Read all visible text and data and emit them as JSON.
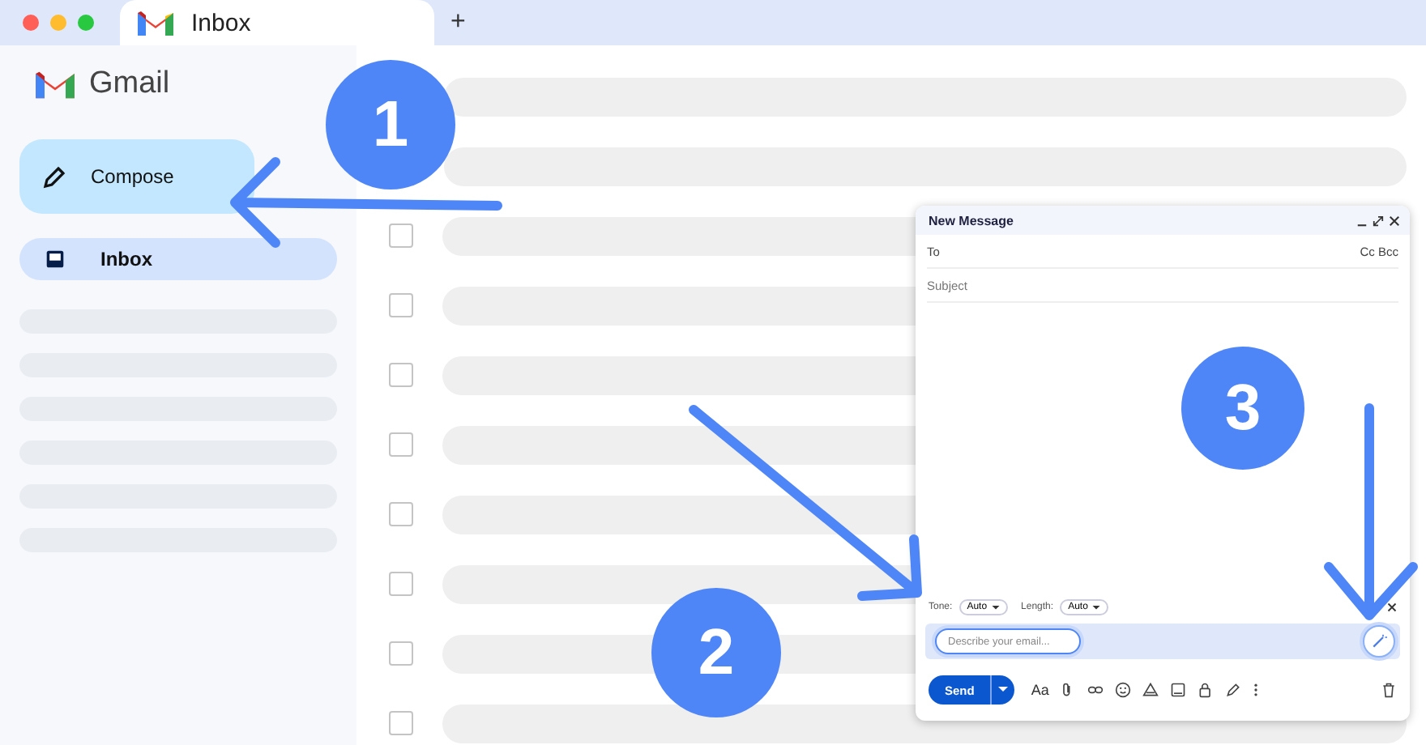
{
  "browser": {
    "tab_title": "Inbox",
    "new_tab": "+"
  },
  "sidebar": {
    "logo_text": "Gmail",
    "compose_label": "Compose",
    "items": [
      {
        "kind": "inbox",
        "label": "Inbox",
        "selected": true
      },
      {
        "kind": "placeholder"
      },
      {
        "kind": "placeholder"
      },
      {
        "kind": "placeholder"
      },
      {
        "kind": "placeholder"
      },
      {
        "kind": "placeholder"
      },
      {
        "kind": "placeholder"
      }
    ]
  },
  "message_rows": [
    {
      "kind": "bar"
    },
    {
      "kind": "bar"
    },
    {
      "kind": "checkbox",
      "checked": false
    },
    {
      "kind": "checkbox",
      "checked": false
    },
    {
      "kind": "checkbox",
      "checked": false
    },
    {
      "kind": "checkbox",
      "checked": false
    },
    {
      "kind": "checkbox",
      "checked": false
    },
    {
      "kind": "checkbox",
      "checked": false
    },
    {
      "kind": "checkbox",
      "checked": false
    },
    {
      "kind": "checkbox",
      "checked": false
    }
  ],
  "compose_window": {
    "title": "New Message",
    "to_label": "To",
    "cc_bcc": "Cc Bcc",
    "subject_placeholder": "Subject",
    "tone_label": "Tone:",
    "tone_value": "Auto",
    "length_label": "Length:",
    "length_value": "Auto",
    "prompt_placeholder": "Describe your email...",
    "send_label": "Send",
    "format_label": "Aa"
  },
  "annotations": [
    "1",
    "2",
    "3"
  ]
}
